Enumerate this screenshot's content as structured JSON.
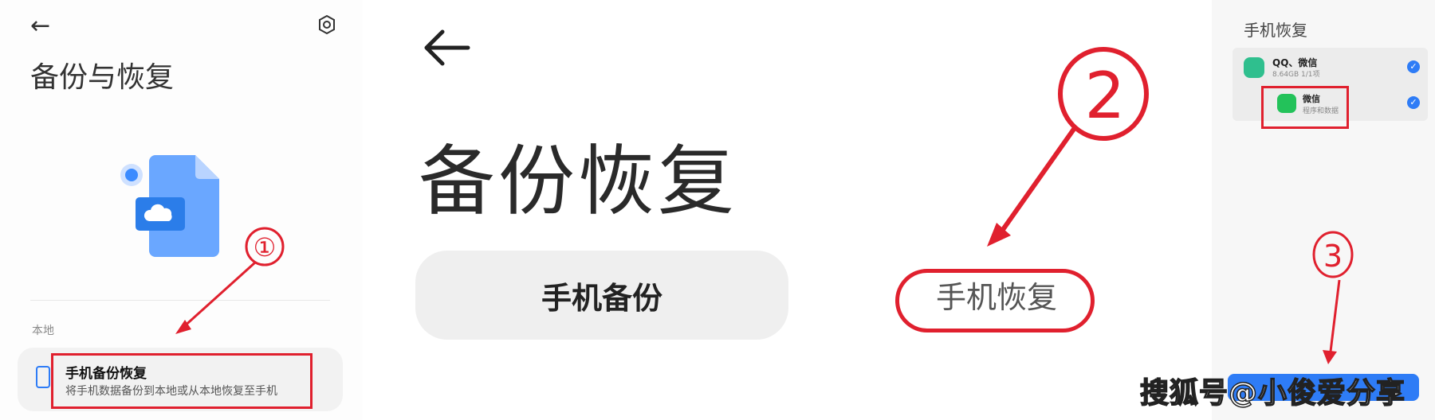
{
  "panel1": {
    "back_label": "←",
    "title": "备份与恢复",
    "section_label": "本地",
    "item": {
      "title": "手机备份恢复",
      "subtitle": "将手机数据备份到本地或从本地恢复至手机"
    }
  },
  "panel2": {
    "title": "备份恢复",
    "backup_button": "手机备份",
    "restore_option": "手机恢复"
  },
  "panel3": {
    "title": "手机恢复",
    "group": {
      "title": "QQ、微信",
      "subtitle": "8.64GB  1/1项"
    },
    "app": {
      "title": "微信",
      "subtitle": "程序和数据"
    }
  },
  "annotations": {
    "step1": "①",
    "step2": "2",
    "step3": "3"
  },
  "watermark": "搜狐号@小俊爱分享",
  "colors": {
    "annotation_red": "#e0202e",
    "accent_blue": "#2e7cf6"
  }
}
